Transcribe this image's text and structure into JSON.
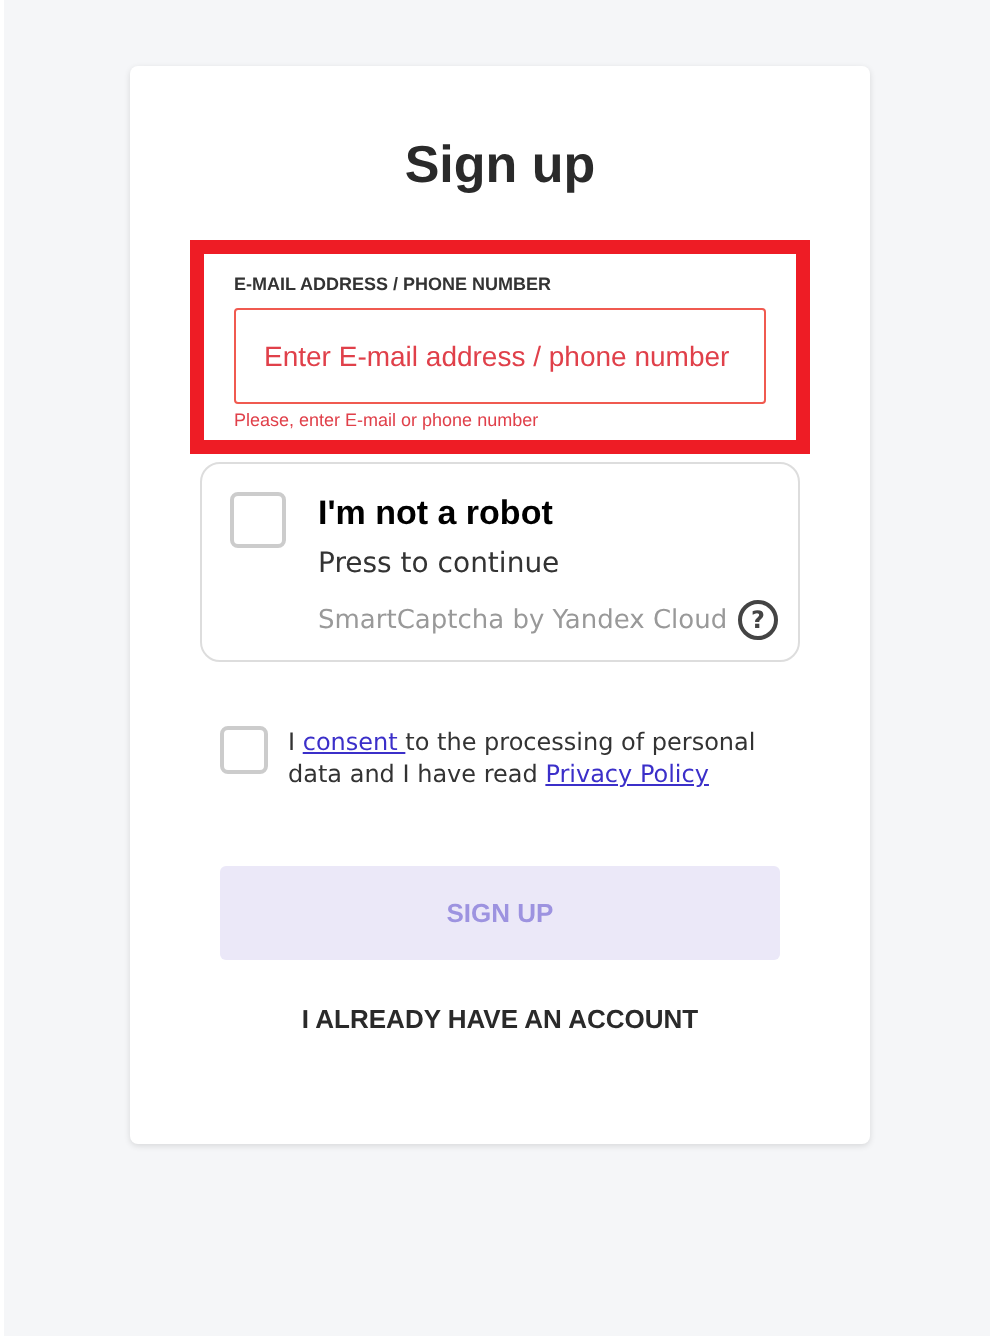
{
  "title": "Sign up",
  "email": {
    "label": "E-MAIL ADDRESS / PHONE NUMBER",
    "placeholder": "Enter E-mail address / phone number",
    "error": "Please, enter E-mail or phone number",
    "highlighted": true,
    "invalid": true
  },
  "captcha": {
    "checked": false,
    "title": "I'm not a robot",
    "subtitle": "Press to continue",
    "brand": "SmartCaptcha by Yandex Cloud",
    "help": "?"
  },
  "consent": {
    "checked": false,
    "before": "I ",
    "consent_link": "consent ",
    "middle": "to the processing of personal data and I have read ",
    "policy_link": "Privacy Policy"
  },
  "submit": {
    "label": "SIGN UP",
    "disabled": true
  },
  "login_link": "I ALREADY HAVE AN ACCOUNT"
}
